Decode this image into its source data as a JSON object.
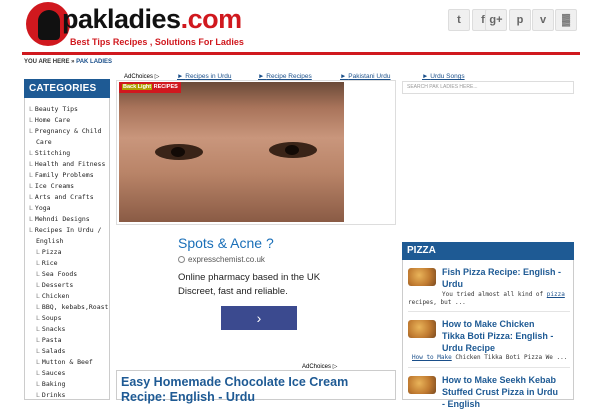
{
  "header": {
    "logo_name": "pakladies",
    "logo_tld": ".com",
    "tagline": "Best Tips Recipes , Solutions For Ladies",
    "social": [
      {
        "icon": "twitter-icon",
        "glyph": "t"
      },
      {
        "icon": "facebook-icon",
        "glyph": "f"
      },
      {
        "icon": "google-plus-icon",
        "glyph": "g+"
      },
      {
        "icon": "pinterest-icon",
        "glyph": "p"
      },
      {
        "icon": "vimeo-icon",
        "glyph": "v"
      },
      {
        "icon": "rss-icon",
        "glyph": "▓"
      }
    ]
  },
  "breadcrumb": {
    "prefix": "YOU ARE HERE »",
    "current": "PAK LADIES"
  },
  "categories": {
    "heading": "CATEGORIES",
    "items": [
      "Beauty Tips",
      "Home Care",
      "Pregnancy & Child",
      "Care",
      "Stitching",
      "Health and Fitness",
      "Family Problems",
      "Ice Creams",
      "Arts and Crafts",
      "Yoga",
      "Mehndi Designs",
      "Recipes In Urdu /",
      "English",
      "Pizza",
      "Rice",
      "Sea Foods",
      "Desserts",
      "Chicken",
      "BBQ, kebabs,Roast",
      "Soups",
      "Snacks",
      "Pasta",
      "Salads",
      "Mutton & Beef",
      "Sauces",
      "Baking",
      "Drinks"
    ]
  },
  "ad_nav": {
    "adchoices": "AdChoices",
    "links": [
      "Recipes in Urdu",
      "Recipe Recipes",
      "Pakistani Urdu",
      "Urdu Songs"
    ]
  },
  "featured": {
    "tag_prefix": "",
    "tag_highlight": "Back Light",
    "tag_suffix": "RECIPES"
  },
  "ad": {
    "title": "Spots & Acne ?",
    "domain": "expresschemist.co.uk",
    "line1": "Online pharmacy based in the UK",
    "line2": "Discreet, fast and reliable.",
    "button_glyph": "›",
    "adchoices": "AdChoices"
  },
  "post": {
    "title": "Easy Homemade Chocolate Ice Cream Recipe: English - Urdu"
  },
  "search": {
    "placeholder": "SEARCH PAK LADIES HERE..."
  },
  "pizza": {
    "heading": "PIZZA",
    "items": [
      {
        "title_l1": "Fish Pizza Recipe: English -",
        "title_l2": "Urdu",
        "excerpt_l1": "You tried almost all kind of ",
        "excerpt_link": "pizza",
        "excerpt_l2": "recipes, but ..."
      },
      {
        "title_l1": "How to Make Chicken",
        "title_l2": "Tikka Boti Pizza: English -",
        "title_l3": "Urdu Recipe",
        "excerpt_link": "How to Make",
        "excerpt_rest": " Chicken Tikka Boti Pizza We ..."
      },
      {
        "title_l1": "How to Make Seekh Kebab",
        "title_l2": "Stuffed Crust Pizza in Urdu",
        "title_l3": "- English"
      }
    ]
  }
}
